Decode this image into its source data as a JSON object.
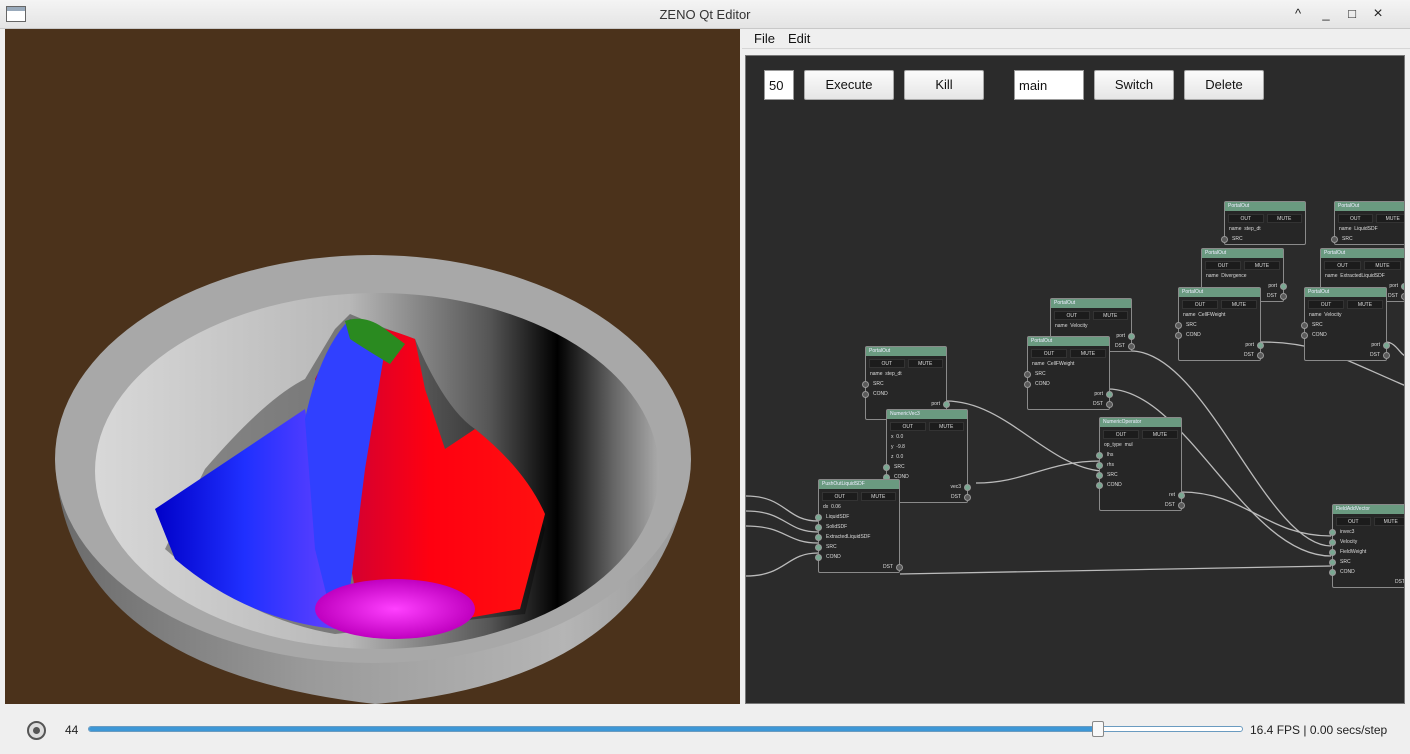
{
  "window": {
    "title": "ZENO Qt Editor",
    "buttons": [
      "^",
      "_",
      "□",
      "×"
    ]
  },
  "menu": {
    "file": "File",
    "edit": "Edit"
  },
  "toolbar": {
    "frames": "50",
    "execute": "Execute",
    "kill": "Kill",
    "graph": "main",
    "switch": "Switch",
    "delete": "Delete"
  },
  "nodes": [
    {
      "title": "PortalOut",
      "out": "OUT",
      "mute": "MUTE",
      "rows": [
        [
          "p",
          "name",
          "step_dt"
        ],
        [
          "i",
          "SRC",
          ""
        ]
      ]
    },
    {
      "title": "PortalOut",
      "out": "OUT",
      "mute": "MUTE",
      "rows": [
        [
          "p",
          "name",
          "LiquidSDF"
        ],
        [
          "i",
          "SRC",
          ""
        ]
      ]
    },
    {
      "title": "PortalOut",
      "out": "OUT",
      "mute": "MUTE",
      "rows": [
        [
          "p",
          "name",
          "Divergence"
        ],
        [
          "o",
          "port",
          ""
        ],
        [
          "o",
          "DST",
          ""
        ]
      ]
    },
    {
      "title": "PortalOut",
      "out": "OUT",
      "mute": "MUTE",
      "rows": [
        [
          "p",
          "name",
          "ExtractedLiquidSDF"
        ],
        [
          "o",
          "port",
          ""
        ],
        [
          "o",
          "DST",
          ""
        ]
      ]
    },
    {
      "title": "PortalOut",
      "out": "OUT",
      "mute": "MUTE",
      "rows": [
        [
          "p",
          "name",
          "CellFWeight"
        ],
        [
          "i",
          "SRC",
          ""
        ],
        [
          "i",
          "COND",
          ""
        ],
        [
          "o",
          "port",
          ""
        ],
        [
          "o",
          "DST",
          ""
        ]
      ]
    },
    {
      "title": "PortalOut",
      "out": "OUT",
      "mute": "MUTE",
      "rows": [
        [
          "p",
          "name",
          "Velocity"
        ],
        [
          "i",
          "SRC",
          ""
        ],
        [
          "i",
          "COND",
          ""
        ],
        [
          "o",
          "port",
          ""
        ],
        [
          "o",
          "DST",
          ""
        ]
      ]
    },
    {
      "title": "PortalOut",
      "out": "OUT",
      "mute": "MUTE",
      "rows": [
        [
          "p",
          "name",
          "Velocity"
        ],
        [
          "o",
          "port",
          ""
        ],
        [
          "o",
          "DST",
          ""
        ]
      ]
    },
    {
      "title": "PortalOut",
      "out": "OUT",
      "mute": "MUTE",
      "rows": [
        [
          "p",
          "name",
          "CellFWeight"
        ],
        [
          "i",
          "SRC",
          ""
        ],
        [
          "i",
          "COND",
          ""
        ],
        [
          "o",
          "port",
          ""
        ],
        [
          "o",
          "DST",
          ""
        ]
      ]
    },
    {
      "title": "PortalOut",
      "out": "OUT",
      "mute": "MUTE",
      "rows": [
        [
          "p",
          "name",
          "step_dt"
        ],
        [
          "i",
          "SRC",
          ""
        ],
        [
          "i",
          "COND",
          ""
        ],
        [
          "o",
          "port",
          ""
        ],
        [
          "o",
          "DST",
          ""
        ]
      ]
    },
    {
      "title": "NumericVec3",
      "out": "OUT",
      "mute": "MUTE",
      "rows": [
        [
          "p",
          "x",
          "0.0"
        ],
        [
          "p",
          "y",
          "-9.8"
        ],
        [
          "p",
          "z",
          "0.0"
        ],
        [
          "i",
          "SRC",
          ""
        ],
        [
          "i",
          "COND",
          ""
        ],
        [
          "o",
          "vec3",
          ""
        ],
        [
          "o",
          "DST",
          ""
        ]
      ]
    },
    {
      "title": "NumericOperator",
      "out": "OUT",
      "mute": "MUTE",
      "rows": [
        [
          "p",
          "op_type",
          "mul"
        ],
        [
          "i",
          "lhs",
          ""
        ],
        [
          "i",
          "rhs",
          ""
        ],
        [
          "i",
          "SRC",
          ""
        ],
        [
          "i",
          "COND",
          ""
        ],
        [
          "o",
          "ret",
          ""
        ],
        [
          "o",
          "DST",
          ""
        ]
      ]
    },
    {
      "title": "PushOutLiquidSDF",
      "out": "OUT",
      "mute": "MUTE",
      "rows": [
        [
          "p",
          "dx",
          "0.06"
        ],
        [
          "i",
          "LiquidSDF",
          ""
        ],
        [
          "i",
          "SolidSDF",
          ""
        ],
        [
          "i",
          "ExtractedLiquidSDF",
          ""
        ],
        [
          "i",
          "SRC",
          ""
        ],
        [
          "i",
          "COND",
          ""
        ],
        [
          "o",
          "DST",
          ""
        ]
      ]
    },
    {
      "title": "FieldAddVector",
      "out": "OUT",
      "mute": "MUTE",
      "rows": [
        [
          "i",
          "invec3",
          ""
        ],
        [
          "i",
          "Velocity",
          ""
        ],
        [
          "i",
          "FieldWeight",
          ""
        ],
        [
          "i",
          "SRC",
          ""
        ],
        [
          "i",
          "COND",
          ""
        ],
        [
          "o",
          "DST",
          ""
        ]
      ]
    }
  ],
  "timeline": {
    "frame": "44",
    "progress": 0.875,
    "fps": "16.4 FPS | 0.00 secs/step"
  },
  "colors": {
    "node_header": "#6a9a80",
    "editor_bg": "#2b2b2b",
    "viewport_bg": "#4b321b",
    "slider": "#3d97d6"
  }
}
